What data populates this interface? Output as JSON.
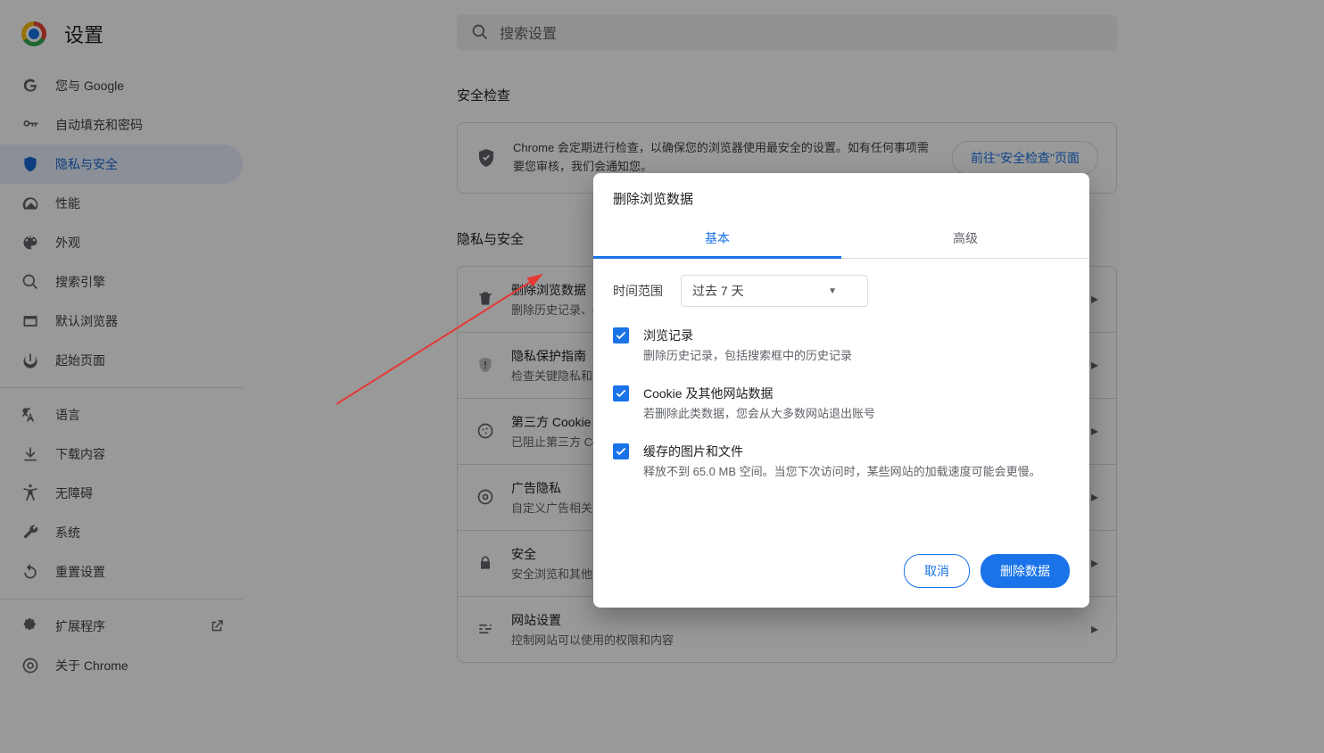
{
  "app_title": "设置",
  "search_placeholder": "搜索设置",
  "nav": {
    "items": [
      {
        "label": "您与 Google"
      },
      {
        "label": "自动填充和密码"
      },
      {
        "label": "隐私与安全"
      },
      {
        "label": "性能"
      },
      {
        "label": "外观"
      },
      {
        "label": "搜索引擎"
      },
      {
        "label": "默认浏览器"
      },
      {
        "label": "起始页面"
      }
    ],
    "items2": [
      {
        "label": "语言"
      },
      {
        "label": "下载内容"
      },
      {
        "label": "无障碍"
      },
      {
        "label": "系统"
      },
      {
        "label": "重置设置"
      }
    ],
    "items3": [
      {
        "label": "扩展程序"
      },
      {
        "label": "关于 Chrome"
      }
    ]
  },
  "sections": {
    "safety_title": "安全检查",
    "safety_text": "Chrome 会定期进行检查，以确保您的浏览器使用最安全的设置。如有任何事项需要您审核，我们会通知您。",
    "safety_btn": "前往\"安全检查\"页面",
    "privacy_title": "隐私与安全",
    "rows": [
      {
        "title": "删除浏览数据",
        "sub": "删除历史记录、Cookie、缓存及其他数据"
      },
      {
        "title": "隐私保护指南",
        "sub": "检查关键隐私和安全控制"
      },
      {
        "title": "第三方 Cookie",
        "sub": "已阻止第三方 Cookie"
      },
      {
        "title": "广告隐私",
        "sub": "自定义广告相关设置"
      },
      {
        "title": "安全",
        "sub": "安全浏览和其他安全设置"
      },
      {
        "title": "网站设置",
        "sub": "控制网站可以使用的权限和内容"
      }
    ]
  },
  "dialog": {
    "title": "删除浏览数据",
    "tab_basic": "基本",
    "tab_advanced": "高级",
    "time_label": "时间范围",
    "time_value": "过去 7 天",
    "checks": [
      {
        "title": "浏览记录",
        "sub": "删除历史记录，包括搜索框中的历史记录"
      },
      {
        "title": "Cookie 及其他网站数据",
        "sub": "若删除此类数据，您会从大多数网站退出账号"
      },
      {
        "title": "缓存的图片和文件",
        "sub": "释放不到 65.0 MB 空间。当您下次访问时，某些网站的加载速度可能会更慢。"
      }
    ],
    "cancel": "取消",
    "confirm": "删除数据"
  }
}
